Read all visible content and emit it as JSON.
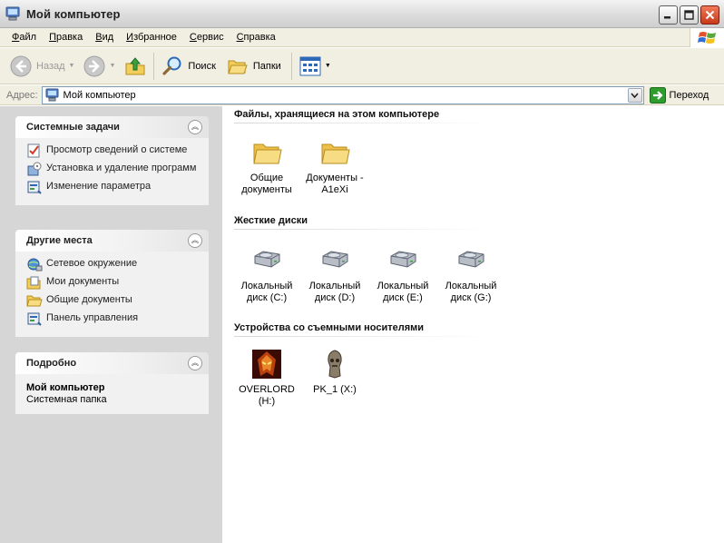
{
  "window": {
    "title": "Мой компьютер",
    "icon": "my-computer-icon",
    "controls": [
      "minimize",
      "maximize",
      "close"
    ]
  },
  "menu": [
    {
      "label": "Файл",
      "key": "Ф",
      "rest": "айл"
    },
    {
      "label": "Правка",
      "key": "П",
      "rest": "равка"
    },
    {
      "label": "Вид",
      "key": "В",
      "rest": "ид"
    },
    {
      "label": "Избранное",
      "key": "И",
      "rest": "збранное"
    },
    {
      "label": "Сервис",
      "key": "С",
      "rest": "ервис"
    },
    {
      "label": "Справка",
      "key": "С",
      "rest": "правка"
    }
  ],
  "toolbar": {
    "back_label": "Назад",
    "search_label": "Поиск",
    "folders_label": "Папки"
  },
  "address": {
    "label": "Адрес:",
    "value": "Мой компьютер",
    "go_label": "Переход"
  },
  "sidebar": {
    "system_tasks": {
      "title": "Системные задачи",
      "items": [
        {
          "label": "Просмотр сведений о системе",
          "icon": "system-info-icon"
        },
        {
          "label": "Установка и удаление программ",
          "icon": "add-remove-programs-icon"
        },
        {
          "label": "Изменение параметра",
          "icon": "control-panel-icon"
        }
      ]
    },
    "other_places": {
      "title": "Другие места",
      "items": [
        {
          "label": "Сетевое окружение",
          "icon": "network-icon"
        },
        {
          "label": "Мои документы",
          "icon": "my-documents-icon"
        },
        {
          "label": "Общие документы",
          "icon": "folder-icon"
        },
        {
          "label": "Панель управления",
          "icon": "control-panel-icon"
        }
      ]
    },
    "details": {
      "title": "Подробно",
      "name": "Мой компьютер",
      "type": "Системная папка"
    }
  },
  "content": {
    "files_group": {
      "title": "Файлы, хранящиеся на этом компьютере",
      "items": [
        {
          "line1": "Общие",
          "line2": "документы"
        },
        {
          "line1": "Документы -",
          "line2": "A1eXi"
        }
      ]
    },
    "hdd_group": {
      "title": "Жесткие диски",
      "items": [
        {
          "line1": "Локальный",
          "line2": "диск (C:)"
        },
        {
          "line1": "Локальный",
          "line2": "диск (D:)"
        },
        {
          "line1": "Локальный",
          "line2": "диск (E:)"
        },
        {
          "line1": "Локальный",
          "line2": "диск (G:)"
        }
      ]
    },
    "removable_group": {
      "title": "Устройства со съемными носителями",
      "items": [
        {
          "line1": "OVERLORD",
          "line2": "(H:)"
        },
        {
          "line1": "PK_1 (X:)",
          "line2": ""
        }
      ]
    }
  },
  "colors": {
    "sidebar_bg": "#d6d6d6",
    "panel_body": "#f1f1f1",
    "chrome_bg": "#f1efe2",
    "address_border": "#7f9db9",
    "go_green": "#2e9d2e"
  }
}
